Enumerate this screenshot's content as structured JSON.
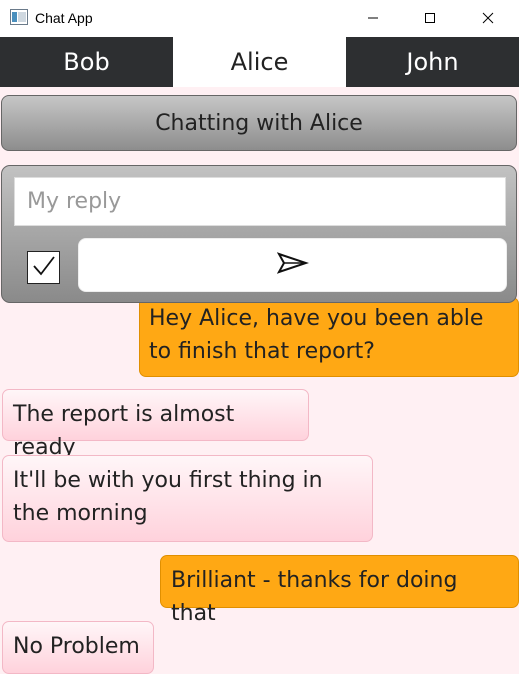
{
  "window": {
    "title": "Chat App",
    "icon": "app-window-icon",
    "controls": [
      "minimize-icon",
      "maximize-icon",
      "close-icon"
    ]
  },
  "tabs": [
    {
      "label": "Bob",
      "active": false
    },
    {
      "label": "Alice",
      "active": true
    },
    {
      "label": "John",
      "active": false
    }
  ],
  "header": {
    "title": "Chatting with Alice"
  },
  "reply": {
    "placeholder": "My reply",
    "value": "",
    "checkbox_checked": true,
    "send_icon": "send-icon"
  },
  "messages": [
    {
      "text": "Hey Alice, have you been able to finish that report?",
      "direction": "outgoing"
    },
    {
      "text": "The report is almost ready",
      "direction": "incoming"
    },
    {
      "text": "It'll be with you first thing in the morning",
      "direction": "incoming"
    },
    {
      "text": "Brilliant - thanks for doing that",
      "direction": "outgoing"
    },
    {
      "text": "No Problem",
      "direction": "incoming"
    }
  ],
  "colors": {
    "tab_inactive_bg": "#2d2f31",
    "outgoing_bubble": "#ffa814",
    "incoming_bubble": "#ffd2dc",
    "chat_bg": "#fff0f3"
  }
}
